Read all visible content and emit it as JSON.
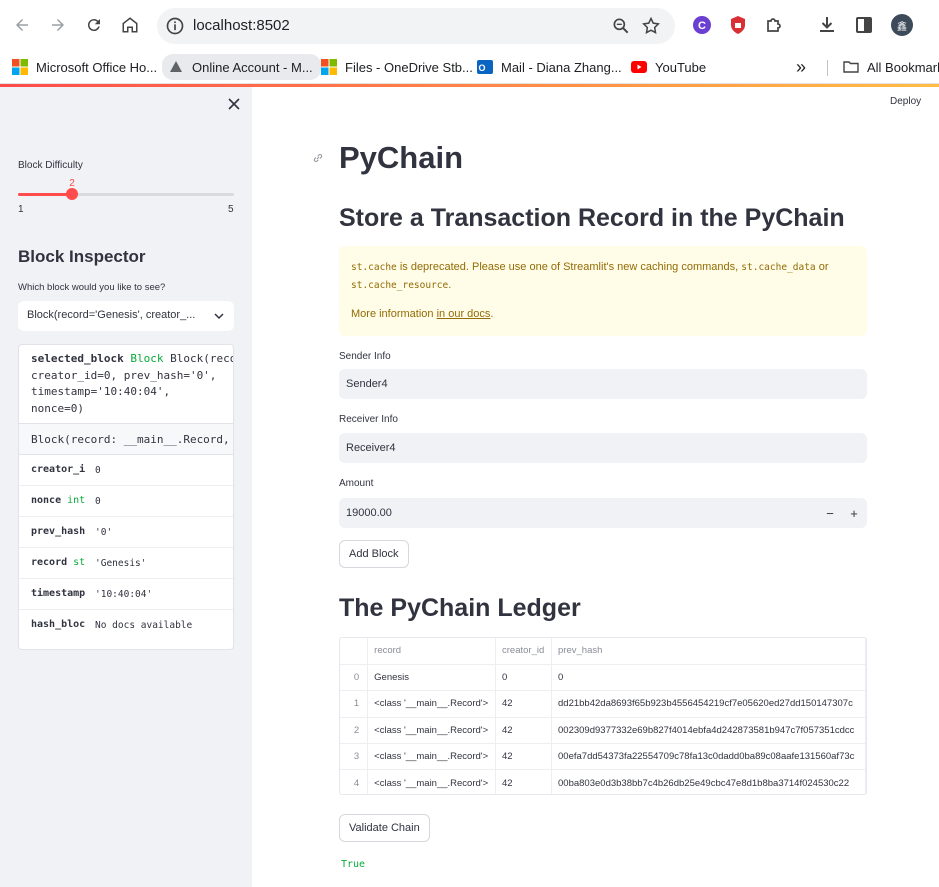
{
  "browser": {
    "url": "localhost:8502",
    "profile_initial": "鑫",
    "colors": {
      "accent_start": "#ff4b4b",
      "accent_end": "#ffbd45"
    }
  },
  "bookmarks": [
    {
      "label": "Microsoft Office Ho...",
      "icon": "microsoft-icon"
    },
    {
      "label": "Online Account - M...",
      "icon": "account-icon"
    },
    {
      "label": "Files - OneDrive Stb...",
      "icon": "microsoft-icon"
    },
    {
      "label": "Mail - Diana Zhang...",
      "icon": "outlook-icon"
    },
    {
      "label": "YouTube",
      "icon": "youtube-icon"
    }
  ],
  "bookmarks_more": "»",
  "bookmarks_all": "All Bookmarks",
  "sidebar": {
    "difficulty_label": "Block Difficulty",
    "difficulty_value": "2",
    "difficulty_min": "1",
    "difficulty_max": "5",
    "difficulty_fraction": 0.25,
    "inspector_title": "Block Inspector",
    "inspector_question": "Which block would you like to see?",
    "selected_option": "Block(record='Genesis', creator_...",
    "help": {
      "var_name": "selected_block",
      "var_type": "Block",
      "repr_l1": "Block(recor",
      "repr_l2": "creator_id=0, prev_hash='0',",
      "repr_l3": "timestamp='10:40:04',",
      "repr_l4": "nonce=0)",
      "doc": "Block(record: __main__.Record, c",
      "rows": [
        {
          "name": "creator_ic",
          "type": "",
          "value": "0"
        },
        {
          "name": "nonce",
          "type": "int",
          "value": "0"
        },
        {
          "name": "prev_hash",
          "type": "",
          "value": "'0'"
        },
        {
          "name": "record",
          "type": "str",
          "value": "'Genesis'"
        },
        {
          "name": "timestamp",
          "type": "",
          "value": "'10:40:04'"
        },
        {
          "name": "hash_block",
          "type": "",
          "value": "No docs available"
        }
      ]
    }
  },
  "main": {
    "deploy": "Deploy",
    "title": "PyChain",
    "subtitle": "Store a Transaction Record in the PyChain",
    "warning": {
      "code1": "st.cache",
      "text1": " is deprecated. Please use one of Streamlit's new caching commands, ",
      "code2": "st.cache_data",
      "text2": " or",
      "code3": "st.cache_resource",
      "text3": ".",
      "more_prefix": "More information ",
      "more_link": "in our docs",
      "more_suffix": "."
    },
    "sender_label": "Sender Info",
    "sender_value": "Sender4",
    "receiver_label": "Receiver Info",
    "receiver_value": "Receiver4",
    "amount_label": "Amount",
    "amount_value": "19000.00",
    "minus": "−",
    "plus": "+",
    "add_block": "Add Block",
    "ledger_title": "The PyChain Ledger",
    "table": {
      "columns": [
        "",
        "record",
        "creator_id",
        "prev_hash"
      ],
      "rows": [
        [
          "0",
          "Genesis",
          "0",
          "0"
        ],
        [
          "1",
          "<class '__main__.Record'>",
          "42",
          "dd21bb42da8693f65b923b4556454219cf7e05620ed27dd150147307c"
        ],
        [
          "2",
          "<class '__main__.Record'>",
          "42",
          "002309d9377332e69b827f4014ebfa4d242873581b947c7f057351cdcc"
        ],
        [
          "3",
          "<class '__main__.Record'>",
          "42",
          "00efa7dd54373fa22554709c78fa13c0dadd0ba89c08aafe131560af73c"
        ],
        [
          "4",
          "<class '__main__.Record'>",
          "42",
          "00ba803e0d3b38bb7c4b26db25e49cbc47e8d1b8ba3714f024530c22"
        ]
      ]
    },
    "validate": "Validate Chain",
    "validate_result": "True"
  }
}
